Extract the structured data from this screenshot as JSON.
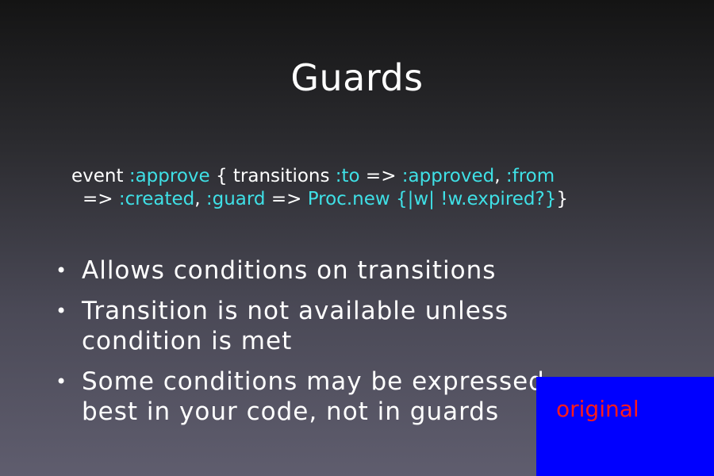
{
  "slide": {
    "title": "Guards",
    "code": {
      "line1": [
        {
          "text": "event ",
          "kind": "plain"
        },
        {
          "text": ":approve",
          "kind": "kw"
        },
        {
          "text": " { transitions ",
          "kind": "plain"
        },
        {
          "text": ":to",
          "kind": "kw"
        },
        {
          "text": " => ",
          "kind": "plain"
        },
        {
          "text": ":approved",
          "kind": "kw"
        },
        {
          "text": ", ",
          "kind": "plain"
        },
        {
          "text": ":from",
          "kind": "kw"
        }
      ],
      "line2": [
        {
          "text": "=> ",
          "kind": "plain"
        },
        {
          "text": ":created",
          "kind": "kw"
        },
        {
          "text": ", ",
          "kind": "plain"
        },
        {
          "text": ":guard",
          "kind": "kw"
        },
        {
          "text": " => ",
          "kind": "plain"
        },
        {
          "text": "Proc.new {|w| !w.expired?}",
          "kind": "kw"
        },
        {
          "text": "}",
          "kind": "plain"
        }
      ]
    },
    "bullets": [
      {
        "lines": [
          "Allows conditions on transitions"
        ]
      },
      {
        "lines": [
          "Transition is not available unless",
          "condition is met"
        ]
      },
      {
        "lines": [
          "Some conditions may be expressed",
          "best in your code, not in guards"
        ]
      }
    ],
    "bullet_marker": "•"
  },
  "overlay": {
    "label": "original",
    "background_color": "#0000ff",
    "text_color": "#ff1a1a"
  },
  "colors": {
    "keyword": "#3fe0e6",
    "text": "#ffffff",
    "background_top": "#141414",
    "background_bottom": "#5f5d6e"
  }
}
